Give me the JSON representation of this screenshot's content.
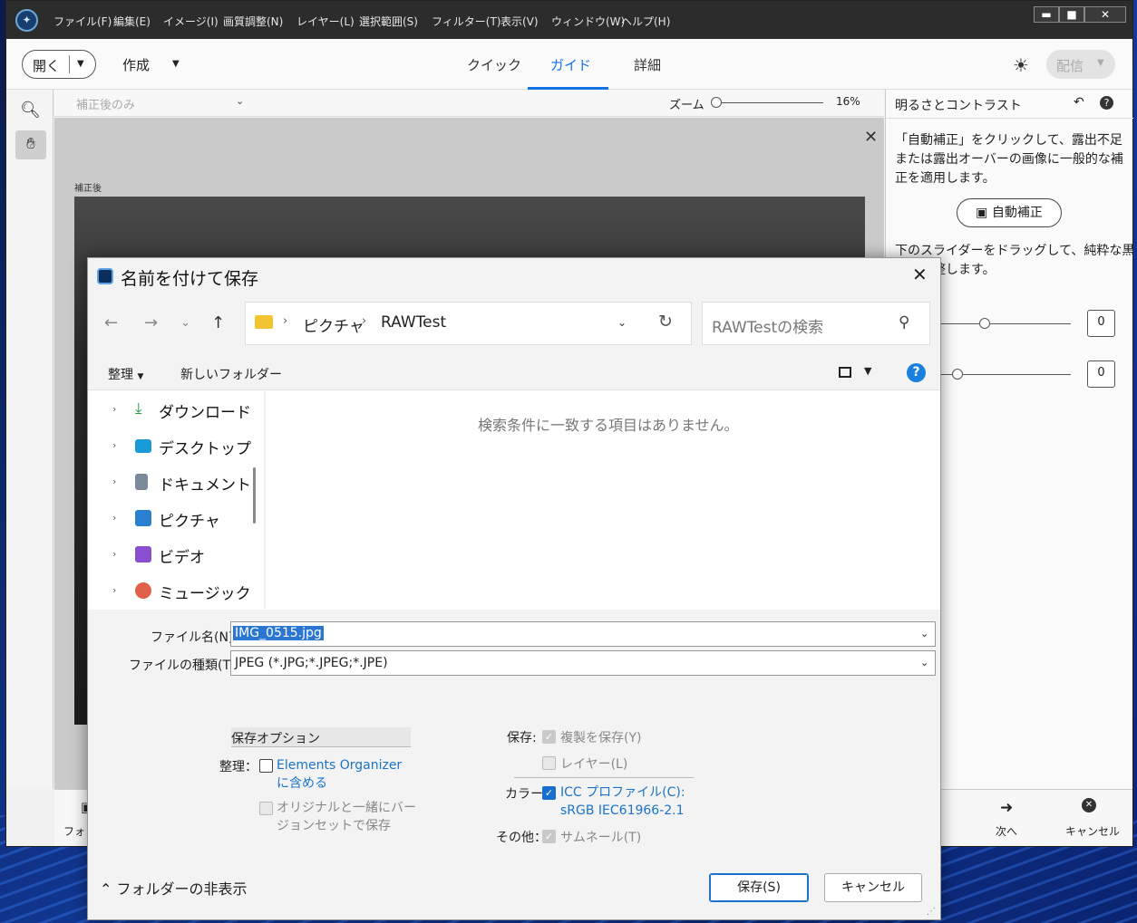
{
  "app": {
    "menu": [
      "ファイル(F)",
      "編集(E)",
      "イメージ(I)",
      "画質調整(N)",
      "レイヤー(L)",
      "選択範囲(S)",
      "フィルター(T)",
      "表示(V)",
      "ウィンドウ(W)",
      "ヘルプ(H)"
    ],
    "window_buttons": [
      "▬",
      "■",
      "✕"
    ]
  },
  "toolbar": {
    "open_label": "開く",
    "create_label": "作成",
    "tabs": [
      "クイック",
      "ガイド",
      "詳細"
    ],
    "active_tab": "ガイド",
    "share_label": "配信"
  },
  "options": {
    "view_mode": "補正後のみ",
    "zoom_label": "ズーム",
    "zoom_value": "16%",
    "zoom_fraction": 0.16
  },
  "canvas": {
    "after_label": "補正後"
  },
  "panel": {
    "title": "明るさとコントラスト",
    "desc1": "「自動補正」をクリックして、露出不足または露出オーバーの画像に一般的な補正を適用します。",
    "auto_fix_label": "自動補正",
    "desc2_line1": "下のスライダーをドラッグして、純粋な黒と純粋",
    "desc2_line2": "を微調整します。",
    "slider1_value": "0",
    "slider2_value": "0"
  },
  "bottom": {
    "photo_label": "フォト",
    "next_label": "次へ",
    "cancel_label": "キャンセル"
  },
  "dialog": {
    "title": "名前を付けて保存",
    "path": [
      "ピクチャ",
      "RAWTest"
    ],
    "search_placeholder": "RAWTestの検索",
    "organize_label": "整理",
    "new_folder_label": "新しいフォルダー",
    "nav_items": [
      {
        "label": "ダウンロード",
        "icon": "download-icon",
        "color": "#2a9d4a"
      },
      {
        "label": "デスクトップ",
        "icon": "desktop-icon",
        "color": "#1a9ad6"
      },
      {
        "label": "ドキュメント",
        "icon": "document-icon",
        "color": "#7a8a99"
      },
      {
        "label": "ピクチャ",
        "icon": "pictures-icon",
        "color": "#2a7fd0"
      },
      {
        "label": "ビデオ",
        "icon": "video-icon",
        "color": "#8a4fd0"
      },
      {
        "label": "ミュージック",
        "icon": "music-icon",
        "color": "#e0604a"
      }
    ],
    "empty_message": "検索条件に一致する項目はありません。",
    "filename_label": "ファイル名(N):",
    "filename_value": "IMG_0515.jpg",
    "filetype_label": "ファイルの種類(T):",
    "filetype_value": "JPEG (*.JPG;*.JPEG;*.JPE)",
    "save_options_title": "保存オプション",
    "organize_field_label": "整理：",
    "organizer_label": "Elements Organizer に含める",
    "version_label": "オリジナルと一緒にバージョンセットで保存",
    "save_label": "保存:",
    "copy_label": "複製を保存(Y)",
    "layer_label": "レイヤー(L)",
    "color_label": "カラー:",
    "icc_label": "ICC プロファイル(C): sRGB IEC61966-2.1",
    "other_label": "その他：",
    "thumbnail_label": "サムネール(T)",
    "hide_folders_label": "フォルダーの非表示",
    "save_button": "保存(S)",
    "cancel_button": "キャンセル"
  },
  "colors": {
    "accent": "#1473e6",
    "link": "#1a73c8",
    "selection": "#2a76d1"
  }
}
